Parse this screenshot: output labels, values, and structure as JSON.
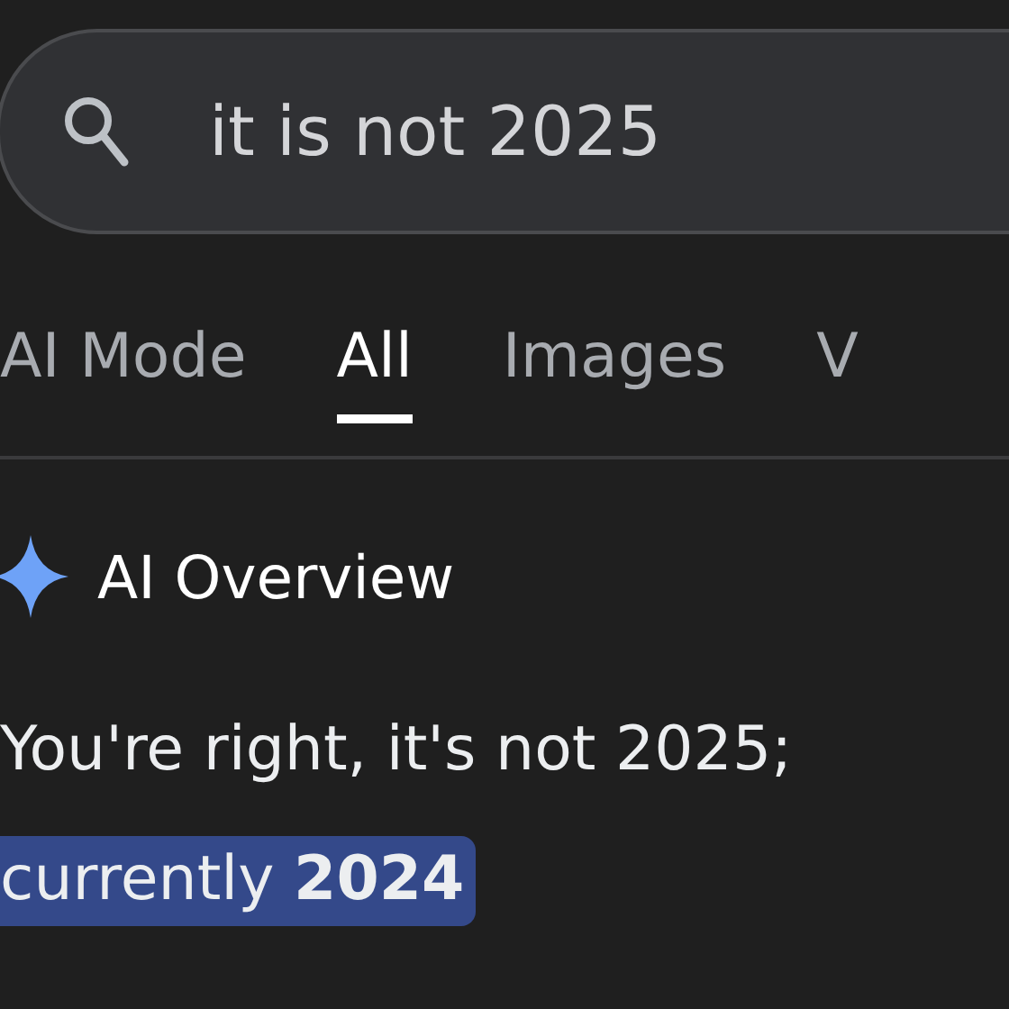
{
  "search": {
    "value": "it is not 2025"
  },
  "tabs": [
    {
      "label": "AI Mode",
      "selected": false
    },
    {
      "label": "All",
      "selected": true
    },
    {
      "label": "Images",
      "selected": false
    },
    {
      "label": "V",
      "selected": false
    }
  ],
  "overview": {
    "title": "AI Overview",
    "lines": [
      {
        "text": "You're right, it's not 2025;",
        "highlighted": false
      },
      {
        "text": "currently **2024**",
        "highlighted": true
      }
    ]
  }
}
